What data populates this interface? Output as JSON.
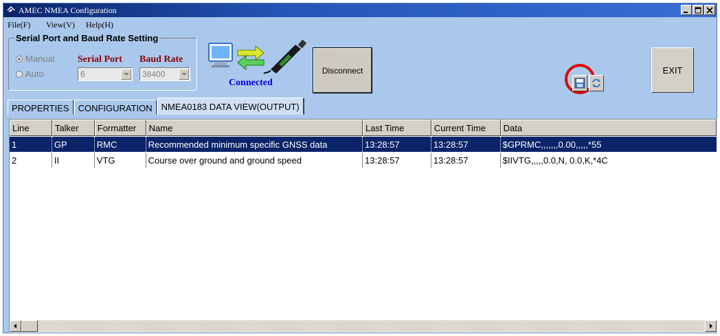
{
  "window": {
    "title": "AMEC NMEA Configuration"
  },
  "menu": {
    "items": [
      "File(F)",
      "View(V)",
      "Help(H)"
    ]
  },
  "serial_group": {
    "title": "Serial Port and Baud Rate Setting",
    "radio_manual": "Manual",
    "radio_auto": "Auto",
    "serial_port_label": "Serial Port",
    "baud_rate_label": "Baud Rate",
    "serial_port_value": "6",
    "baud_rate_value": "38400",
    "status": "Connected"
  },
  "buttons": {
    "disconnect": "Disconnect",
    "exit": "EXIT"
  },
  "tabs": [
    "PROPERTIES",
    "CONFIGURATION",
    "NMEA0183 DATA VIEW(OUTPUT)"
  ],
  "table": {
    "columns": [
      "Line",
      "Talker",
      "Formatter",
      "Name",
      "Last Time",
      "Current Time",
      "Data"
    ],
    "rows": [
      [
        "1",
        "GP",
        "RMC",
        "Recommended minimum specific GNSS data",
        "13:28:57",
        "13:28:57",
        "$GPRMC,,,,,,,0.00,,,,,*55"
      ],
      [
        "2",
        "II",
        "VTG",
        "Course over ground and ground speed",
        "13:28:57",
        "13:28:57",
        "$IIVTG,,,,,0.0,N, 0.0,K,*4C"
      ]
    ]
  },
  "colors": {
    "accent_highlight": "#e00000",
    "selection": "#0a246a",
    "status_text": "#0000e0",
    "label_text": "#8b0000"
  }
}
